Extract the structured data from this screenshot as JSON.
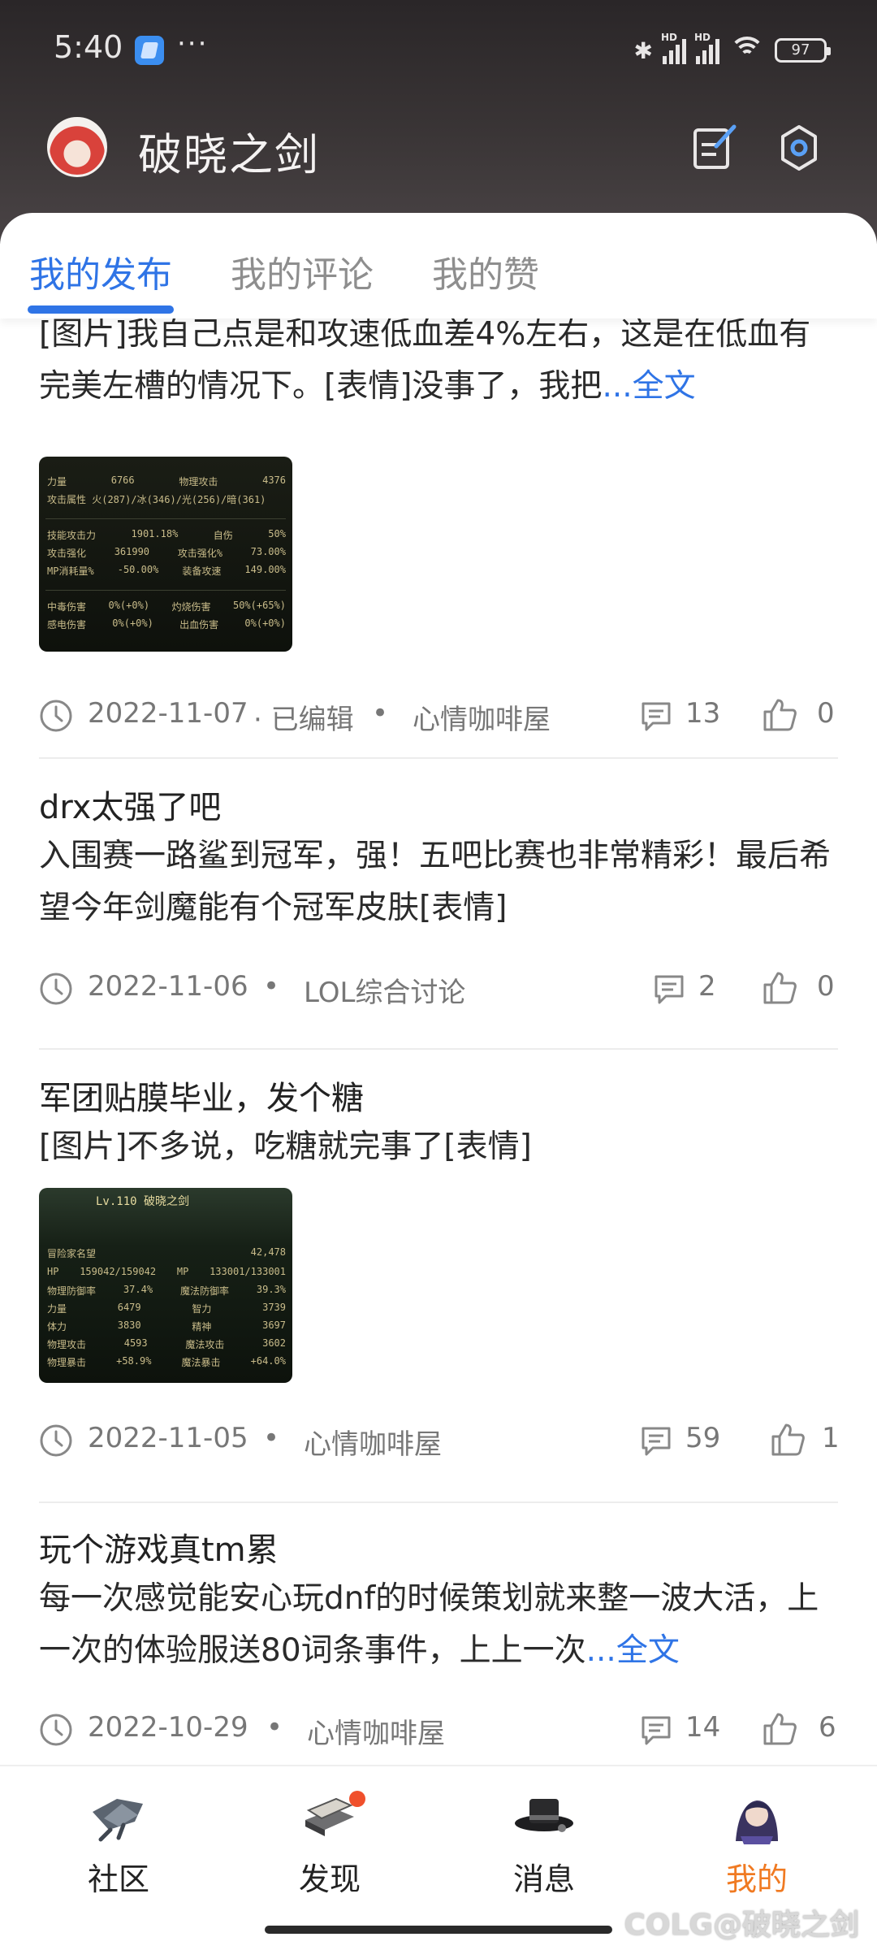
{
  "status_bar": {
    "time": "5:40",
    "more": "···",
    "battery": "97"
  },
  "header": {
    "username": "破晓之剑",
    "edit_icon": "edit-icon",
    "settings_icon": "gear-icon"
  },
  "tabs": [
    {
      "label": "我的发布",
      "active": true
    },
    {
      "label": "我的评论",
      "active": false
    },
    {
      "label": "我的赞",
      "active": false
    }
  ],
  "posts": [
    {
      "body": "[图片]我自己点是和攻速低血差4%左右，这是在低血有完美左槽的情况下。[表情]没事了，我把",
      "more": "...全文",
      "thumb_rows": [
        [
          "力量",
          "6766",
          "物理攻击",
          "4376"
        ],
        [
          "攻击属性 火(287)/冰(346)/光(256)/暗(361)"
        ],
        [
          "技能攻击力",
          "1901.18%",
          "自伤",
          "50%"
        ],
        [
          "攻击强化",
          "361990",
          "攻击强化%",
          "73.00%"
        ],
        [
          "MP消耗量%",
          "-50.00%",
          "装备攻速",
          "149.00%"
        ],
        [
          "中毒伤害",
          "0%(+0%)",
          "灼烧伤害",
          "50%(+65%)"
        ],
        [
          "感电伤害",
          "0%(+0%)",
          "出血伤害",
          "0%(+0%)"
        ]
      ],
      "date": "2022-11-07",
      "edited": "· 已编辑",
      "forum": "心情咖啡屋",
      "comments": "13",
      "likes": "0"
    },
    {
      "title": "drx太强了吧",
      "body": "入围赛一路鲨到冠军，强！五吧比赛也非常精彩！最后希望今年剑魔能有个冠军皮肤[表情]",
      "date": "2022-11-06",
      "forum": "LOL综合讨论",
      "comments": "2",
      "likes": "0"
    },
    {
      "title": "军团贴膜毕业，发个糖",
      "body": "[图片]不多说，吃糖就完事了[表情]",
      "thumb_header": "Lv.110 破晓之剑",
      "thumb_rows": [
        [
          "冒险家名望",
          "42,478"
        ],
        [
          "HP",
          "159042/159042",
          "MP",
          "133001/133001"
        ],
        [
          "物理防御率",
          "37.4%",
          "魔法防御率",
          "39.3%"
        ],
        [
          "力量",
          "6479",
          "智力",
          "3739"
        ],
        [
          "体力",
          "3830",
          "精神",
          "3697"
        ],
        [
          "物理攻击",
          "4593",
          "魔法攻击",
          "3602"
        ],
        [
          "物理暴击",
          "+58.9%",
          "魔法暴击",
          "+64.0%"
        ]
      ],
      "date": "2022-11-05",
      "forum": "心情咖啡屋",
      "comments": "59",
      "likes": "1"
    },
    {
      "title": "玩个游戏真tm累",
      "body": "每一次感觉能安心玩dnf的时候策划就来整一波大活，上一次的体验服送80词条事件，上上一次",
      "more": "...全文",
      "date": "2022-10-29",
      "forum": "心情咖啡屋",
      "comments": "14",
      "likes": "6"
    }
  ],
  "bottom_nav": [
    {
      "label": "社区",
      "icon": "community-icon",
      "active": false
    },
    {
      "label": "发现",
      "icon": "discover-icon",
      "active": false,
      "badge": true
    },
    {
      "label": "消息",
      "icon": "message-icon",
      "active": false
    },
    {
      "label": "我的",
      "icon": "profile-avatar-icon",
      "active": true
    }
  ],
  "watermark": "@破晓之剑",
  "colors": {
    "accent": "#2f74e6",
    "active_nav": "#f07a22",
    "badge": "#f0502c"
  }
}
